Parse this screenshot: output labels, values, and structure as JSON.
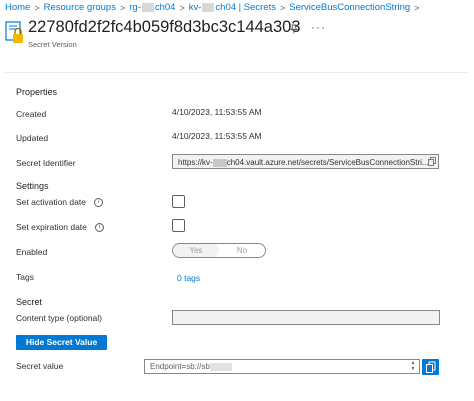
{
  "breadcrumb": {
    "home": "Home",
    "resource_groups": "Resource groups",
    "rg_prefix": "rg-",
    "rg_suffix": "ch04",
    "kv_prefix": "kv-",
    "kv_suffix": "ch04 | Secrets",
    "current": "ServiceBusConnectionString",
    "separator": ">"
  },
  "header": {
    "title": "22780fd2f2fc4b059f8d3bc3c144a303",
    "subtitle": "Secret Version",
    "pin_icon": "pin-icon",
    "more_icon": "more-icon"
  },
  "properties": {
    "heading": "Properties",
    "created_label": "Created",
    "created_value": "4/10/2023, 11:53:55 AM",
    "updated_label": "Updated",
    "updated_value": "4/10/2023, 11:53:55 AM",
    "identifier_label": "Secret Identifier",
    "identifier_prefix": "https://kv-",
    "identifier_suffix": "ch04.vault.azure.net/secrets/ServiceBusConnectionStri..."
  },
  "settings": {
    "heading": "Settings",
    "activation_label": "Set activation date",
    "expiration_label": "Set expiration date",
    "enabled_label": "Enabled",
    "enabled_yes": "Yes",
    "enabled_no": "No",
    "tags_label": "Tags",
    "tags_value": "0 tags"
  },
  "secret": {
    "heading": "Secret",
    "content_type_label": "Content type (optional)",
    "content_type_value": "",
    "hide_button": "Hide Secret Value",
    "value_label": "Secret value",
    "value_text": "Endpoint=sb://sb"
  },
  "colors": {
    "accent": "#0078d4",
    "text": "#323130",
    "border": "#8a8886"
  }
}
